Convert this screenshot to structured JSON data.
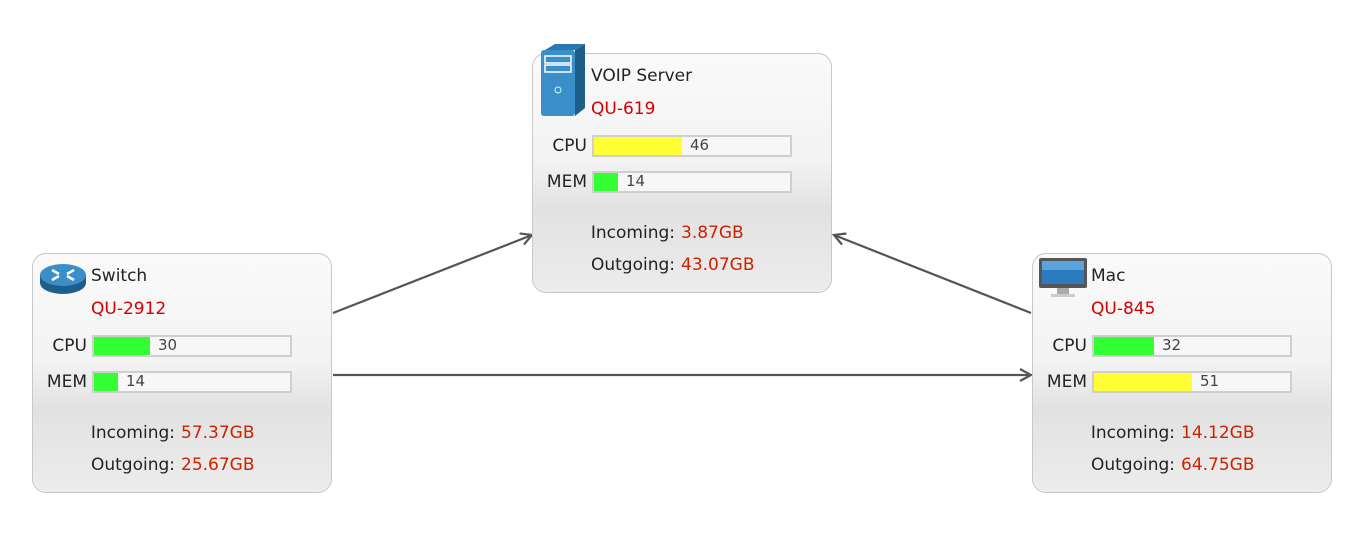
{
  "nodes": [
    {
      "key": "switch",
      "title": "Switch",
      "id": "QU-2912",
      "icon": "router-icon",
      "cpu": {
        "label": "CPU",
        "value": 30
      },
      "mem": {
        "label": "MEM",
        "value": 14
      },
      "incoming": {
        "label": "Incoming:",
        "value": "57.37GB"
      },
      "outgoing": {
        "label": "Outgoing:",
        "value": "25.67GB"
      }
    },
    {
      "key": "voip",
      "title": "VOIP Server",
      "id": "QU-619",
      "icon": "server-icon",
      "cpu": {
        "label": "CPU",
        "value": 46
      },
      "mem": {
        "label": "MEM",
        "value": 14
      },
      "incoming": {
        "label": "Incoming:",
        "value": "3.87GB"
      },
      "outgoing": {
        "label": "Outgoing:",
        "value": "43.07GB"
      }
    },
    {
      "key": "mac",
      "title": "Mac",
      "id": "QU-845",
      "icon": "monitor-icon",
      "cpu": {
        "label": "CPU",
        "value": 32
      },
      "mem": {
        "label": "MEM",
        "value": 51
      },
      "incoming": {
        "label": "Incoming:",
        "value": "14.12GB"
      },
      "outgoing": {
        "label": "Outgoing:",
        "value": "64.75GB"
      }
    }
  ],
  "links": [
    {
      "from": "Switch",
      "to": "VOIP Server"
    },
    {
      "from": "Switch",
      "to": "Mac"
    },
    {
      "from": "Mac",
      "to": "VOIP Server"
    }
  ],
  "colors": {
    "low": "#33ff33",
    "mid": "#ffff33",
    "id": "#d40000",
    "traffic": "#cc2200",
    "link": "#555555"
  }
}
